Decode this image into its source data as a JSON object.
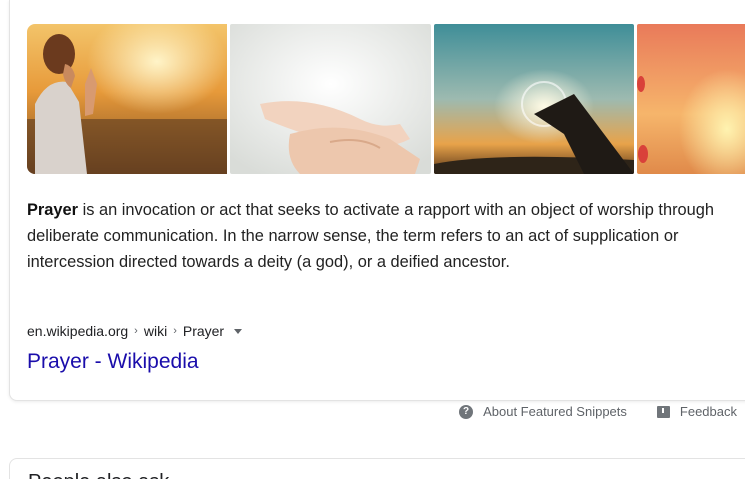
{
  "snippet": {
    "images": [
      {
        "icon": "praying-woman-sunset-image"
      },
      {
        "icon": "open-hands-light-image"
      },
      {
        "icon": "hands-raised-sun-image"
      },
      {
        "icon": "sunset-sky-image"
      }
    ],
    "description_term": "Prayer",
    "description_rest": " is an invocation or act that seeks to activate a rapport with an object of worship through deliberate communication. In the narrow sense, the term refers to an act of supplication or intercession directed towards a deity (a god), or a deified ancestor.",
    "breadcrumb": {
      "domain": "en.wikipedia.org",
      "separator": "›",
      "parts": [
        "wiki",
        "Prayer"
      ]
    },
    "title": "Prayer - Wikipedia"
  },
  "footer": {
    "about_label": "About Featured Snippets",
    "feedback_label": "Feedback"
  },
  "next_card": {
    "title": "People also ask"
  },
  "colors": {
    "link": "#1a0dab",
    "text": "#222222",
    "muted": "#5f6368"
  }
}
